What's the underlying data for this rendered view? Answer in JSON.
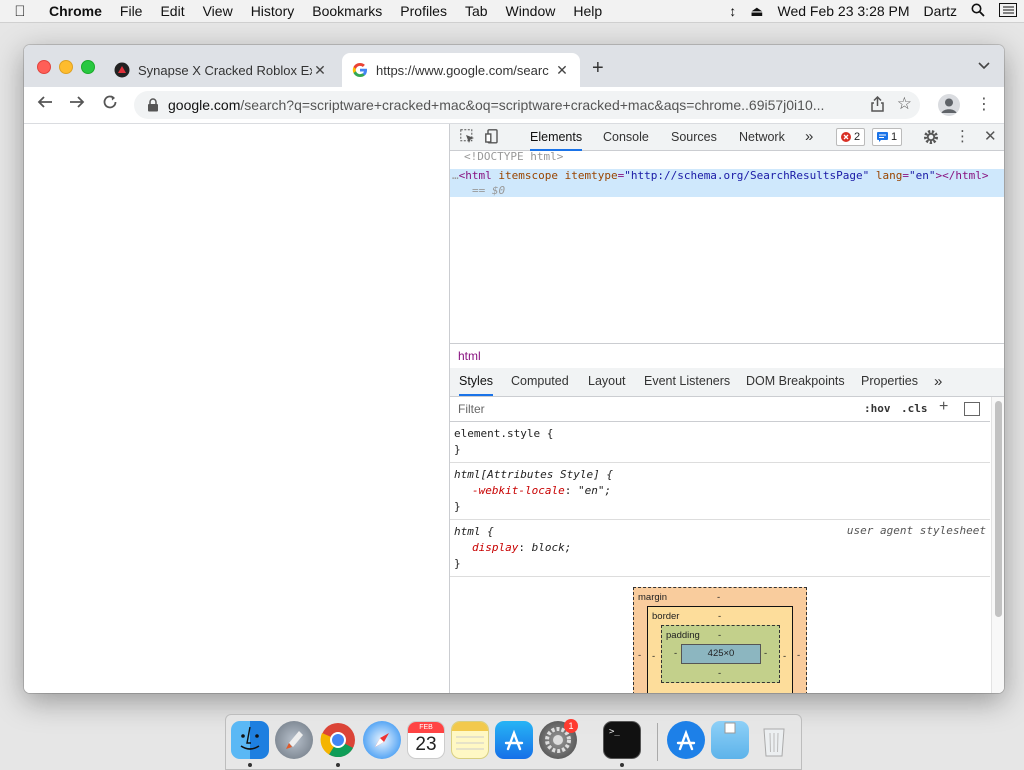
{
  "menubar": {
    "app": "Chrome",
    "items": [
      "File",
      "Edit",
      "View",
      "History",
      "Bookmarks",
      "Profiles",
      "Tab",
      "Window",
      "Help"
    ],
    "datetime": "Wed Feb 23  3:28 PM",
    "user": "Dartz"
  },
  "browser": {
    "tabs": [
      {
        "title": "Synapse X Cracked Roblox Exp",
        "active": false
      },
      {
        "title": "https://www.google.com/searc",
        "active": true
      }
    ],
    "omnibox": {
      "host": "google.com",
      "path": "/search?q=scriptware+cracked+mac&oq=scriptware+cracked+mac&aqs=chrome..69i57j0i10..."
    }
  },
  "devtools": {
    "tabs": [
      "Elements",
      "Console",
      "Sources",
      "Network"
    ],
    "selected_tab": "Elements",
    "more": "»",
    "errors": "2",
    "messages": "1",
    "dom": {
      "doctype": "<!DOCTYPE html>",
      "html_open": "<html",
      "attr1": "itemscope",
      "attr2": "itemtype",
      "attr2_val": "\"http://schema.org/SearchResultsPage\"",
      "attr3": "lang",
      "attr3_val": "\"en\"",
      "html_close": "></html>",
      "eq": "== $0",
      "ellipsis": "…"
    },
    "breadcrumb": "html",
    "styles_tabs": [
      "Styles",
      "Computed",
      "Layout",
      "Event Listeners",
      "DOM Breakpoints",
      "Properties"
    ],
    "styles_more": "»",
    "filter": {
      "placeholder": "Filter",
      "hov": ":hov",
      "cls": ".cls",
      "plus": "+"
    },
    "rules": {
      "r1_selector": "element.style {",
      "r1_close": "}",
      "r2_selector": "html[Attributes Style] {",
      "r2_prop": "-webkit-locale",
      "r2_val": "\"en\";",
      "r2_close": "}",
      "r3_selector": "html {",
      "r3_source": "user agent stylesheet",
      "r3_prop": "display",
      "r3_val": "block;",
      "r3_close": "}"
    },
    "box_model": {
      "margin": "margin",
      "border": "border",
      "padding": "padding",
      "content": "425×0",
      "dash": "-"
    }
  },
  "dock": {
    "calendar_month": "FEB",
    "calendar_day": "23",
    "notification_badge": "1"
  }
}
